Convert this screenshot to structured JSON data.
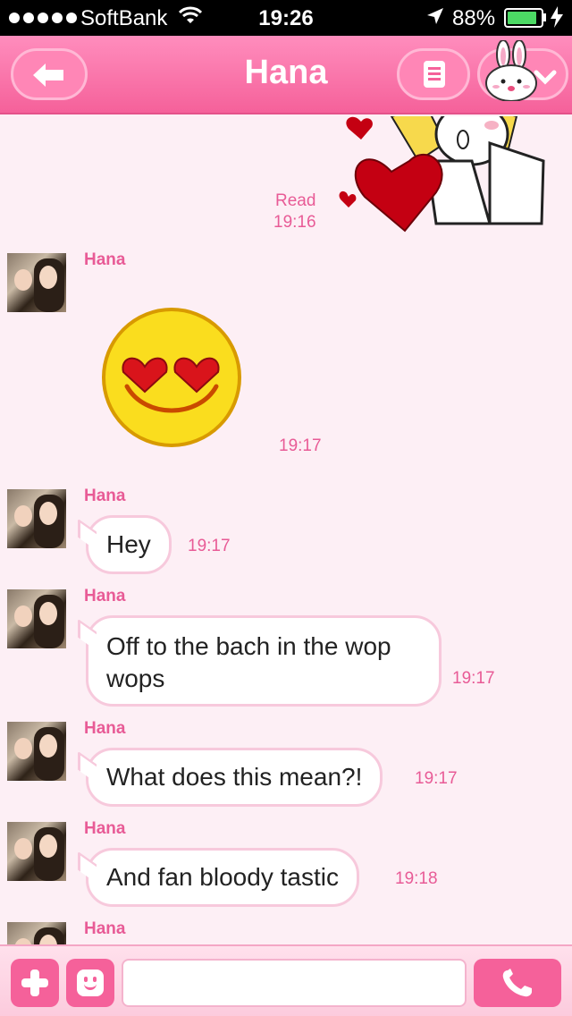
{
  "status_bar": {
    "carrier": "SoftBank",
    "time": "19:26",
    "battery": "88%",
    "battery_level": 0.88
  },
  "nav": {
    "title": "Hana",
    "back_icon": "back-arrow-icon",
    "menu_icon": "notes-icon",
    "friend_icon": "bunny-avatar-icon"
  },
  "top_sticker": {
    "read_label": "Read",
    "time": "19:16"
  },
  "messages": [
    {
      "sender": "Hana",
      "type": "sticker",
      "sticker": "heart-eyes-emoji",
      "time": "19:17"
    },
    {
      "sender": "Hana",
      "type": "text",
      "line1": "Hey",
      "line2": "",
      "time": "19:17"
    },
    {
      "sender": "Hana",
      "type": "text",
      "line1": "Off to the bach in the wop",
      "line2": "wops",
      "time": "19:17"
    },
    {
      "sender": "Hana",
      "type": "text",
      "line1": "What does this mean?!",
      "line2": "",
      "time": "19:17"
    },
    {
      "sender": "Hana",
      "type": "text",
      "line1": "And fan bloody tastic",
      "line2": "",
      "time": "19:18"
    },
    {
      "sender": "Hana",
      "type": "partial",
      "time": ""
    }
  ],
  "input_bar": {
    "plus_icon": "plus-icon",
    "emoji_icon": "emoji-icon",
    "message_value": "",
    "call_icon": "phone-icon"
  },
  "colors": {
    "accent": "#f5619a",
    "background": "#fdeff5",
    "time_text": "#e85b96",
    "bubble_border": "#f7c9dc"
  }
}
